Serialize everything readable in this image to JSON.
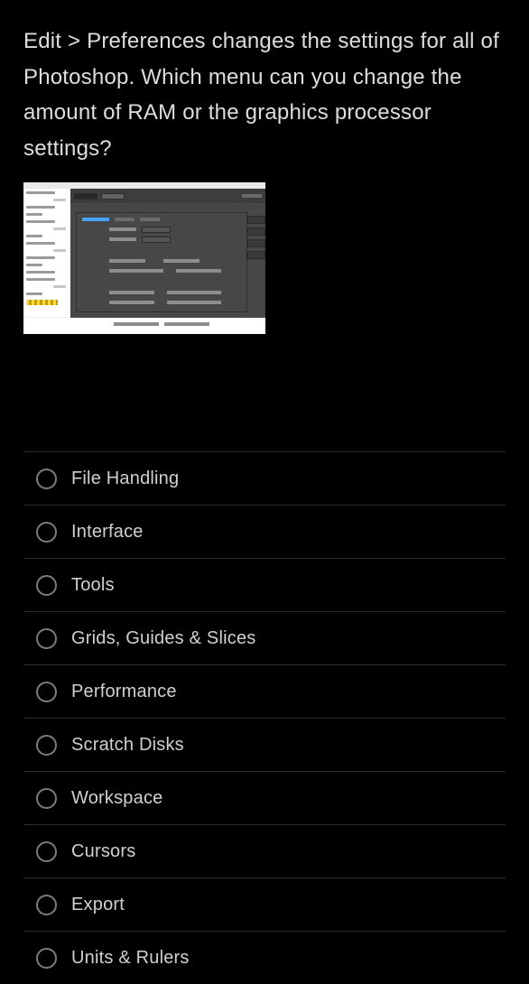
{
  "question": "Edit > Preferences changes the settings for all of Photoshop.  Which menu can you change the amount of RAM or the graphics processor settings?",
  "options": [
    {
      "label": "File Handling"
    },
    {
      "label": "Interface"
    },
    {
      "label": "Tools"
    },
    {
      "label": "Grids, Guides & Slices"
    },
    {
      "label": "Performance"
    },
    {
      "label": "Scratch Disks"
    },
    {
      "label": "Workspace"
    },
    {
      "label": "Cursors"
    },
    {
      "label": "Export"
    },
    {
      "label": "Units & Rulers"
    }
  ]
}
